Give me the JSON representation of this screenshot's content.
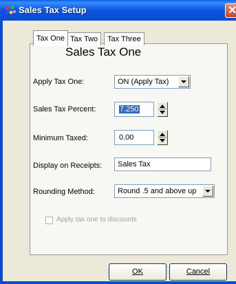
{
  "window": {
    "title": "Sales Tax Setup",
    "icon": "multicolor-dots-icon",
    "close_icon": "close-icon"
  },
  "tabs": [
    {
      "label": "Tax One",
      "active": true
    },
    {
      "label": "Tax Two",
      "active": false
    },
    {
      "label": "Tax Three",
      "active": false
    }
  ],
  "panel": {
    "heading": "Sales Tax  One",
    "apply_tax": {
      "label": "Apply Tax One:",
      "value": "ON  (Apply Tax)"
    },
    "percent": {
      "label": "Sales Tax Percent:",
      "value": "7.250"
    },
    "minimum": {
      "label": "Minimum Taxed:",
      "value": "0.00"
    },
    "display": {
      "label": "Display on Receipts:",
      "value": "Sales Tax"
    },
    "rounding": {
      "label": "Rounding Method:",
      "value": "Round .5 and above up"
    },
    "discount_checkbox": {
      "label": "Apply tax one to discounts",
      "checked": false,
      "disabled": true
    }
  },
  "buttons": {
    "ok": "OK",
    "cancel": "Cancel"
  },
  "colors": {
    "titlebar": "#0a4bd0",
    "selection": "#316ac5",
    "close": "#c6452b"
  }
}
